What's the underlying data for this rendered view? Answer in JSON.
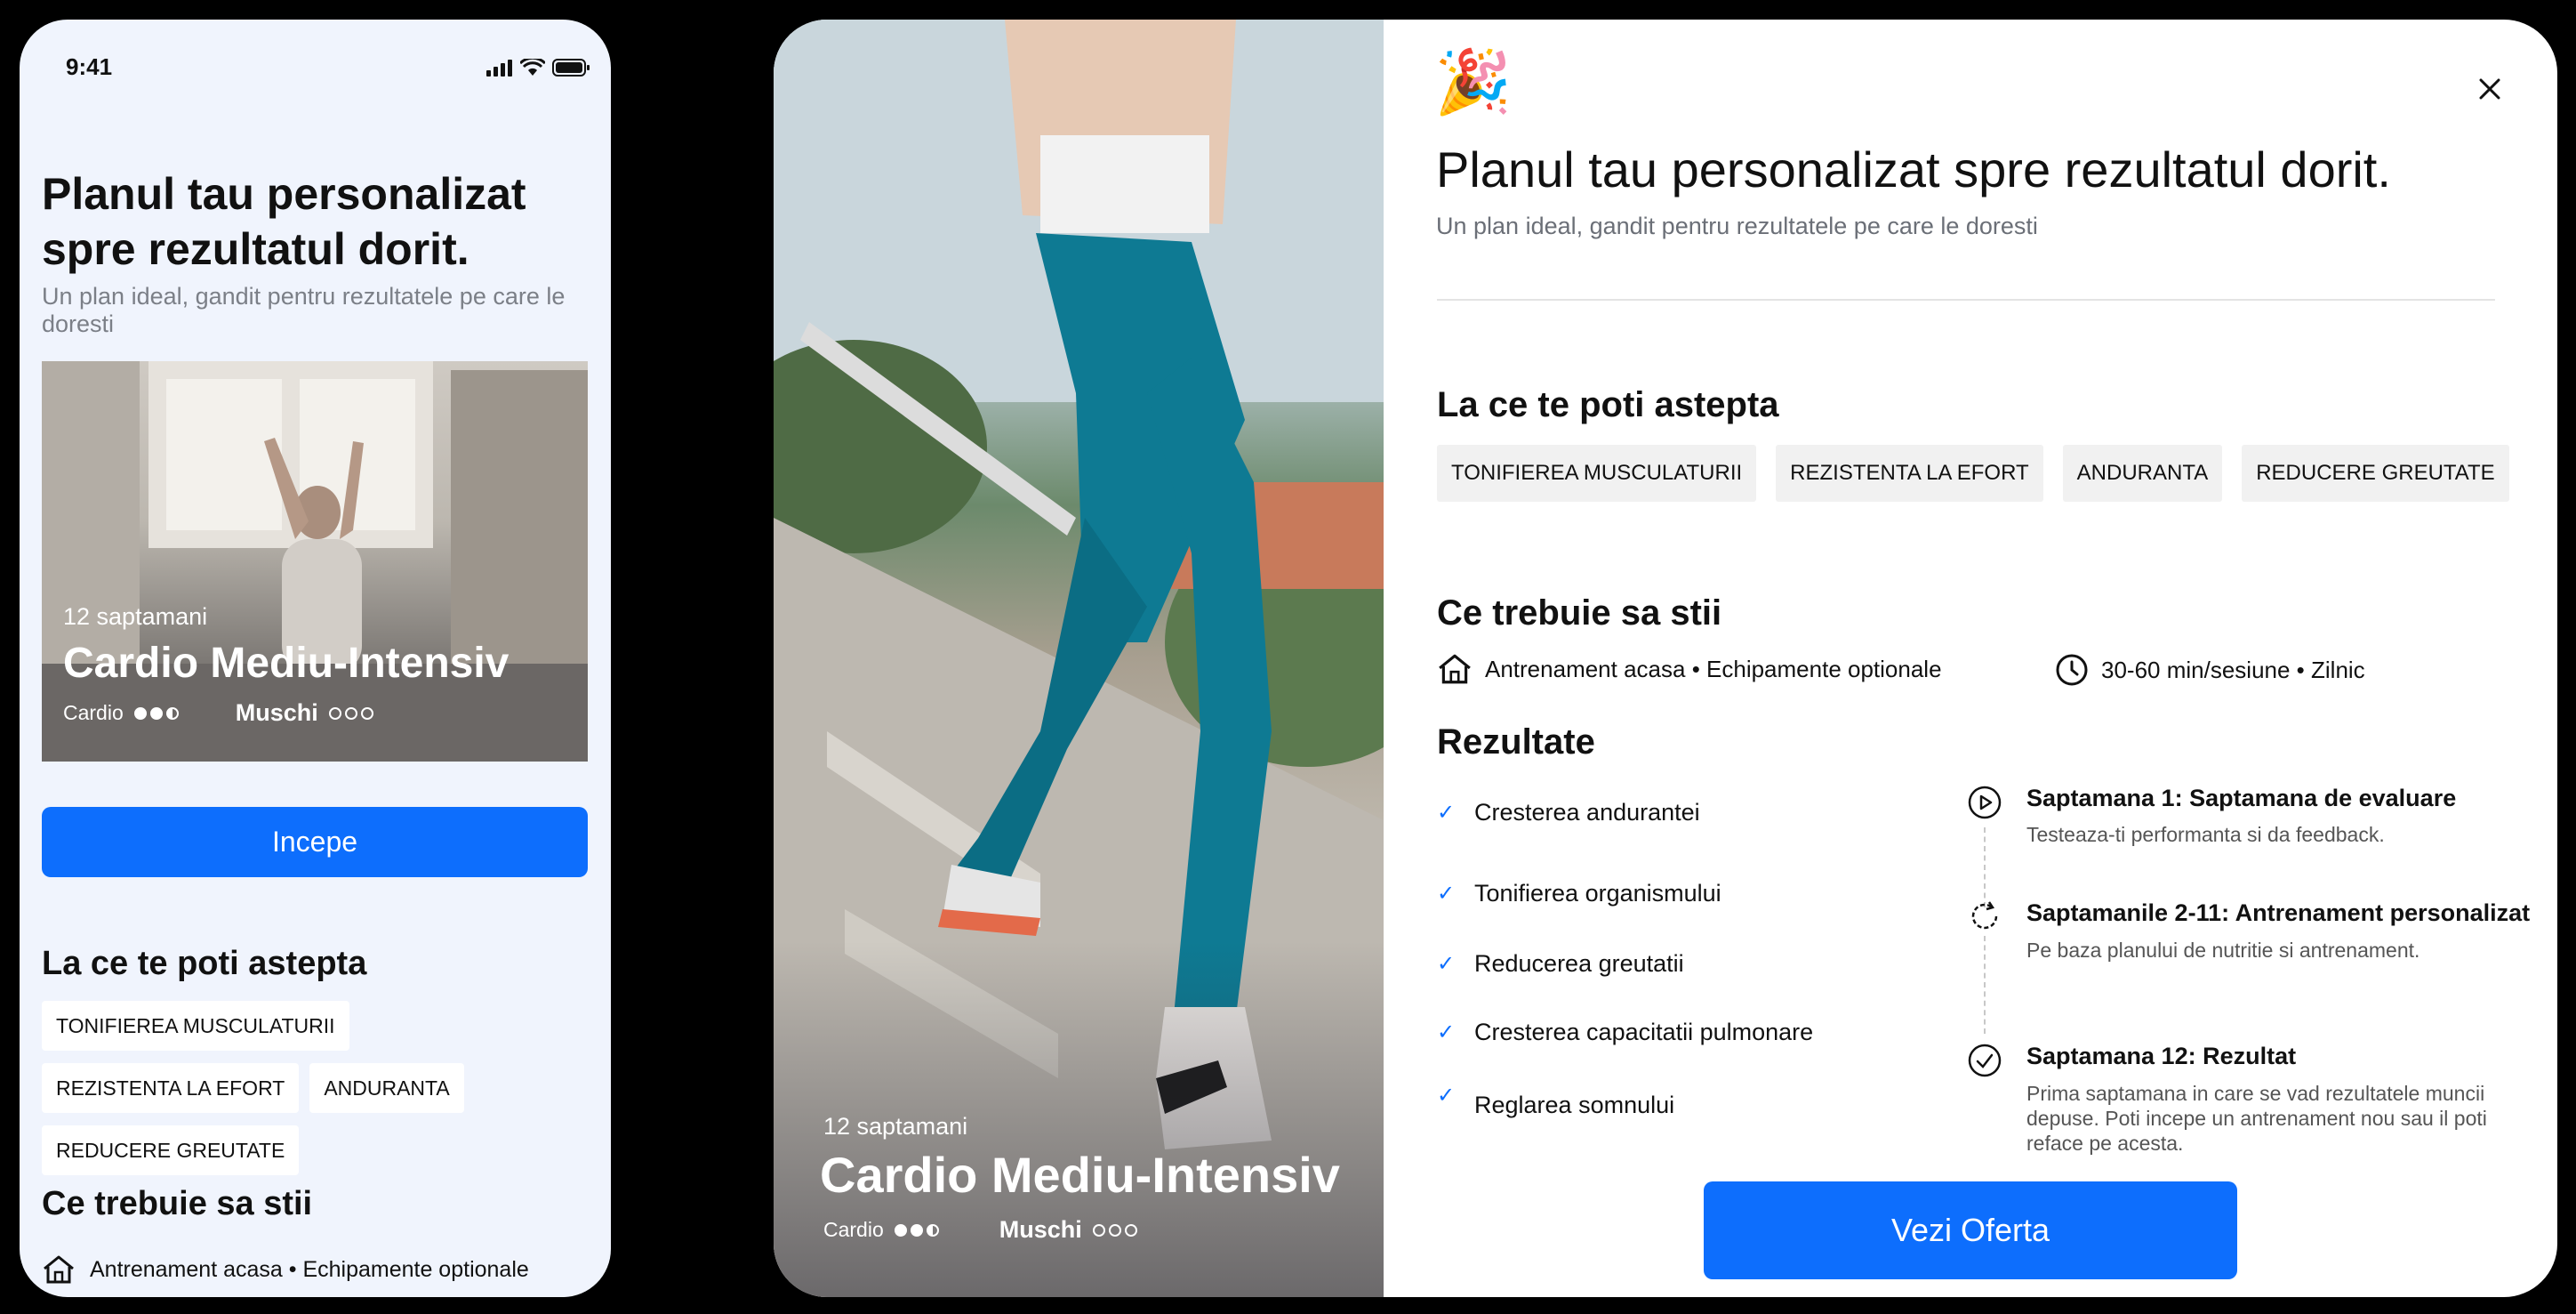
{
  "phone": {
    "time": "9:41",
    "title": "Planul tau personalizat spre rezultatul dorit.",
    "subtitle": "Un plan ideal, gandit pentru rezultatele pe care le doresti",
    "card": {
      "weeks": "12 saptamani",
      "name": "Cardio Mediu-Intensiv",
      "meta1": "Cardio",
      "meta2": "Muschi"
    },
    "start_button": "Incepe",
    "expect_heading": "La ce te poti astepta",
    "tags": [
      "TONIFIEREA MUSCULATURII",
      "REZISTENTA LA EFORT",
      "ANDURANTA",
      "REDUCERE GREUTATE"
    ],
    "know_heading": "Ce trebuie sa stii",
    "info": "Antrenament acasa • Echipamente optionale"
  },
  "tablet": {
    "hero": {
      "weeks": "12 saptamani",
      "name": "Cardio Mediu-Intensiv",
      "meta1": "Cardio",
      "meta2": "Muschi"
    },
    "title": "Planul tau personalizat spre rezultatul dorit.",
    "subtitle": "Un plan ideal, gandit pentru rezultatele pe care le doresti",
    "expect_heading": "La ce te poti astepta",
    "tags": [
      "TONIFIEREA MUSCULATURII",
      "REZISTENTA LA EFORT",
      "ANDURANTA",
      "REDUCERE GREUTATE"
    ],
    "know_heading": "Ce trebuie sa stii",
    "info_location": "Antrenament acasa • Echipamente optionale",
    "info_time": "30-60 min/sesiune  • Zilnic",
    "results_heading": "Rezultate",
    "results": [
      "Cresterea andurantei",
      "Tonifierea organismului",
      "Reducerea greutatii",
      "Cresterea capacitatii pulmonare",
      "Reglarea somnului"
    ],
    "timeline": [
      {
        "title": "Saptamana 1: Saptamana de evaluare",
        "desc": "Testeaza-ti performanta si da feedback."
      },
      {
        "title": "Saptamanile 2-11: Antrenament personalizat",
        "desc": "Pe baza planului de nutritie si antrenament."
      },
      {
        "title": "Saptamana 12: Rezultat",
        "desc": "Prima saptamana in care se vad rezultatele muncii depuse. Poti incepe un antrenament nou sau il poti reface pe acesta."
      }
    ],
    "offer_button": "Vezi Oferta"
  },
  "colors": {
    "accent": "#0d6efd",
    "phone_bg": "#f0f4fd",
    "tag_bg": "#f1f1f1"
  },
  "intensity": {
    "cardio_level": 2.5,
    "cardio_max": 3,
    "muschi_level": 0,
    "muschi_max": 3
  }
}
